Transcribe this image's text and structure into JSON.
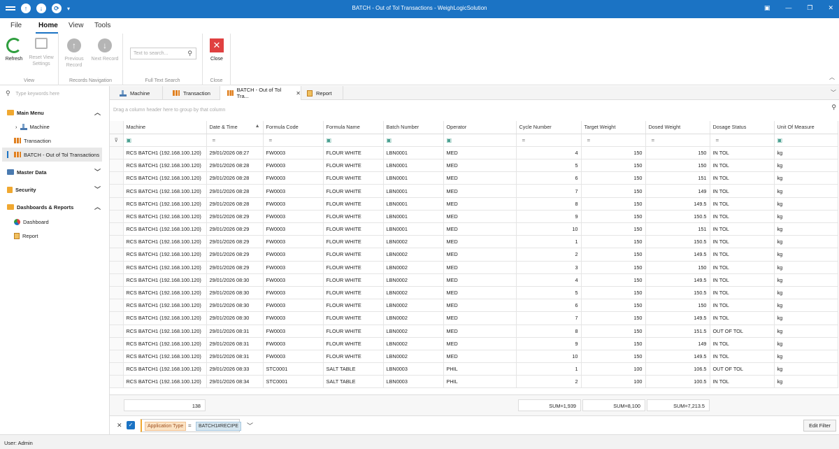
{
  "window": {
    "title": "BATCH - Out of Tol Transactions - WeighLogicSolution"
  },
  "menu": {
    "tabs": [
      "File",
      "Home",
      "View",
      "Tools"
    ],
    "active": "Home"
  },
  "ribbon": {
    "refresh": "Refresh",
    "reset_view": "Reset View Settings",
    "group_view": "View",
    "previous_record": "Previous Record",
    "next_record": "Next Record",
    "group_nav": "Records Navigation",
    "search_placeholder": "Text to search...",
    "group_search": "Full Text Search",
    "close": "Close",
    "group_close": "Close"
  },
  "sidebar": {
    "search_placeholder": "Type keywords here",
    "main_menu": "Main Menu",
    "machine": "Machine",
    "transaction": "Transaction",
    "batch": "BATCH - Out of Tol Transactions",
    "master_data": "Master Data",
    "security": "Security",
    "dashboards_reports": "Dashboards & Reports",
    "dashboard": "Dashboard",
    "report": "Report"
  },
  "doc_tabs": [
    "Machine",
    "Transaction",
    "BATCH - Out of Tol Tra...",
    "Report"
  ],
  "group_panel_text": "Drag a column header here to group by that column",
  "grid": {
    "columns": [
      "Machine",
      "Date & Time",
      "Formula Code",
      "Formula Name",
      "Batch Number",
      "Operator",
      "Cycle Number",
      "Target Weight",
      "Dosed Weight",
      "Dosage Status",
      "Unit Of Measure"
    ],
    "rows": [
      [
        "RCS BATCH1 (192.168.100.120)",
        "29/01/2026 08:27",
        "FW0003",
        "FLOUR WHITE",
        "LBN0001",
        "MED",
        "4",
        "150",
        "150",
        "IN TOL",
        "kg"
      ],
      [
        "RCS BATCH1 (192.168.100.120)",
        "29/01/2026 08:28",
        "FW0003",
        "FLOUR WHITE",
        "LBN0001",
        "MED",
        "5",
        "150",
        "150",
        "IN TOL",
        "kg"
      ],
      [
        "RCS BATCH1 (192.168.100.120)",
        "29/01/2026 08:28",
        "FW0003",
        "FLOUR WHITE",
        "LBN0001",
        "MED",
        "6",
        "150",
        "151",
        "IN TOL",
        "kg"
      ],
      [
        "RCS BATCH1 (192.168.100.120)",
        "29/01/2026 08:28",
        "FW0003",
        "FLOUR WHITE",
        "LBN0001",
        "MED",
        "7",
        "150",
        "149",
        "IN TOL",
        "kg"
      ],
      [
        "RCS BATCH1 (192.168.100.120)",
        "29/01/2026 08:28",
        "FW0003",
        "FLOUR WHITE",
        "LBN0001",
        "MED",
        "8",
        "150",
        "149.5",
        "IN TOL",
        "kg"
      ],
      [
        "RCS BATCH1 (192.168.100.120)",
        "29/01/2026 08:29",
        "FW0003",
        "FLOUR WHITE",
        "LBN0001",
        "MED",
        "9",
        "150",
        "150.5",
        "IN TOL",
        "kg"
      ],
      [
        "RCS BATCH1 (192.168.100.120)",
        "29/01/2026 08:29",
        "FW0003",
        "FLOUR WHITE",
        "LBN0001",
        "MED",
        "10",
        "150",
        "151",
        "IN TOL",
        "kg"
      ],
      [
        "RCS BATCH1 (192.168.100.120)",
        "29/01/2026 08:29",
        "FW0003",
        "FLOUR WHITE",
        "LBN0002",
        "MED",
        "1",
        "150",
        "150.5",
        "IN TOL",
        "kg"
      ],
      [
        "RCS BATCH1 (192.168.100.120)",
        "29/01/2026 08:29",
        "FW0003",
        "FLOUR WHITE",
        "LBN0002",
        "MED",
        "2",
        "150",
        "149.5",
        "IN TOL",
        "kg"
      ],
      [
        "RCS BATCH1 (192.168.100.120)",
        "29/01/2026 08:29",
        "FW0003",
        "FLOUR WHITE",
        "LBN0002",
        "MED",
        "3",
        "150",
        "150",
        "IN TOL",
        "kg"
      ],
      [
        "RCS BATCH1 (192.168.100.120)",
        "29/01/2026 08:30",
        "FW0003",
        "FLOUR WHITE",
        "LBN0002",
        "MED",
        "4",
        "150",
        "149.5",
        "IN TOL",
        "kg"
      ],
      [
        "RCS BATCH1 (192.168.100.120)",
        "29/01/2026 08:30",
        "FW0003",
        "FLOUR WHITE",
        "LBN0002",
        "MED",
        "5",
        "150",
        "150.5",
        "IN TOL",
        "kg"
      ],
      [
        "RCS BATCH1 (192.168.100.120)",
        "29/01/2026 08:30",
        "FW0003",
        "FLOUR WHITE",
        "LBN0002",
        "MED",
        "6",
        "150",
        "150",
        "IN TOL",
        "kg"
      ],
      [
        "RCS BATCH1 (192.168.100.120)",
        "29/01/2026 08:30",
        "FW0003",
        "FLOUR WHITE",
        "LBN0002",
        "MED",
        "7",
        "150",
        "149.5",
        "IN TOL",
        "kg"
      ],
      [
        "RCS BATCH1 (192.168.100.120)",
        "29/01/2026 08:31",
        "FW0003",
        "FLOUR WHITE",
        "LBN0002",
        "MED",
        "8",
        "150",
        "151.5",
        "OUT OF TOL",
        "kg"
      ],
      [
        "RCS BATCH1 (192.168.100.120)",
        "29/01/2026 08:31",
        "FW0003",
        "FLOUR WHITE",
        "LBN0002",
        "MED",
        "9",
        "150",
        "149",
        "IN TOL",
        "kg"
      ],
      [
        "RCS BATCH1 (192.168.100.120)",
        "29/01/2026 08:31",
        "FW0003",
        "FLOUR WHITE",
        "LBN0002",
        "MED",
        "10",
        "150",
        "149.5",
        "IN TOL",
        "kg"
      ],
      [
        "RCS BATCH1 (192.168.100.120)",
        "29/01/2026 08:33",
        "STC0001",
        "SALT TABLE",
        "LBN0003",
        "PHIL",
        "1",
        "100",
        "106.5",
        "OUT OF TOL",
        "kg"
      ],
      [
        "RCS BATCH1 (192.168.100.120)",
        "29/01/2026 08:34",
        "STC0001",
        "SALT TABLE",
        "LBN0003",
        "PHIL",
        "2",
        "100",
        "100.5",
        "IN TOL",
        "kg"
      ]
    ]
  },
  "summary": {
    "count": "138",
    "cycle_sum": "SUM=1,939",
    "target_sum": "SUM=8,100",
    "dosed_sum": "SUM=7,213.5"
  },
  "filter": {
    "field": "Application Type",
    "operator": "=",
    "value": "BATCH1#RECIPE",
    "edit_label": "Edit Filter"
  },
  "status": {
    "user": "User: Admin"
  },
  "colors": {
    "accent": "#1b73c4",
    "titlebar": "#1b73c4"
  }
}
